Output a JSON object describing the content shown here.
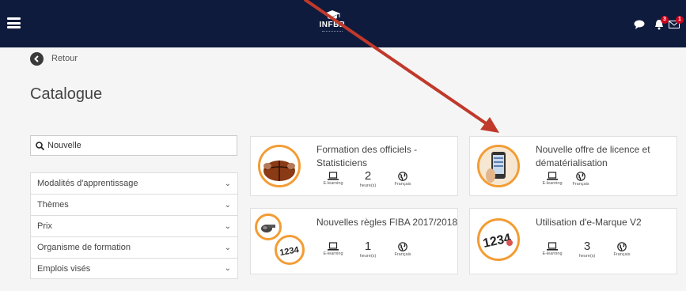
{
  "header": {
    "logo_text": "INFBB",
    "notifications_count": "3",
    "messages_count": "1"
  },
  "back_label": "Retour",
  "page_title": "Catalogue",
  "search": {
    "value": "Nouvelle",
    "placeholder": ""
  },
  "filters": [
    {
      "label": "Modalités d'apprentissage"
    },
    {
      "label": "Thèmes"
    },
    {
      "label": "Prix"
    },
    {
      "label": "Organisme de formation"
    },
    {
      "label": "Emplois visés"
    }
  ],
  "courses": [
    {
      "title": "Formation des officiels - Statisticiens",
      "modality": "E-learning",
      "duration": "2",
      "duration_unit": "heure(s)",
      "language": "Français",
      "thumb": "basketball"
    },
    {
      "title": "Nouvelle offre de licence et dématérialisation",
      "modality": "E-learning",
      "duration": "",
      "duration_unit": "",
      "language": "Français",
      "thumb": "phone"
    },
    {
      "title": "Nouvelles règles FIBA 2017/2018",
      "modality": "E-learning",
      "duration": "1",
      "duration_unit": "heure(s)",
      "language": "Français",
      "thumb": "whistle-numbers"
    },
    {
      "title": "Utilisation d'e-Marque V2",
      "modality": "E-learning",
      "duration": "3",
      "duration_unit": "heure(s)",
      "language": "Français",
      "thumb": "numbers"
    }
  ],
  "colors": {
    "header_bg": "#0f1b3d",
    "accent_orange": "#f39c34",
    "arrow_red": "#c0392b",
    "badge_red": "#d0021b"
  }
}
